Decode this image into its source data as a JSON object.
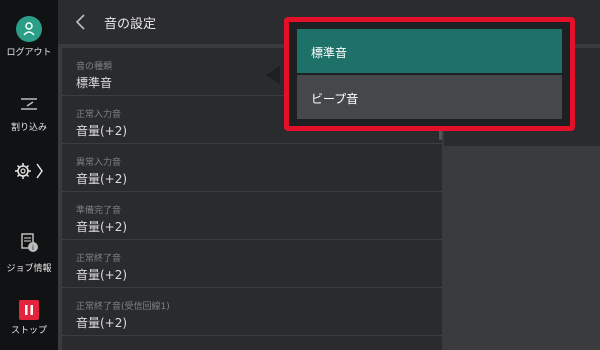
{
  "sidebar": {
    "logout_label": "ログアウト",
    "interrupt_label": "割り込み",
    "jobinfo_label": "ジョブ情報",
    "stop_label": "ストップ"
  },
  "header": {
    "title": "音の設定"
  },
  "list": [
    {
      "label": "音の種類",
      "value": "標準音"
    },
    {
      "label": "正常入力音",
      "value": "音量(+2)"
    },
    {
      "label": "異常入力音",
      "value": "音量(+2)"
    },
    {
      "label": "準備完了音",
      "value": "音量(+2)"
    },
    {
      "label": "正常終了音",
      "value": "音量(+2)"
    },
    {
      "label": "正常終了音(受信回線1)",
      "value": "音量(+2)"
    }
  ],
  "dropdown": {
    "options": [
      "標準音",
      "ビープ音"
    ],
    "selected": "標準音"
  },
  "colors": {
    "accent": "#1e7169",
    "highlight_frame": "#e4102a",
    "stop": "#e4243d",
    "logout": "#2b9e88"
  }
}
